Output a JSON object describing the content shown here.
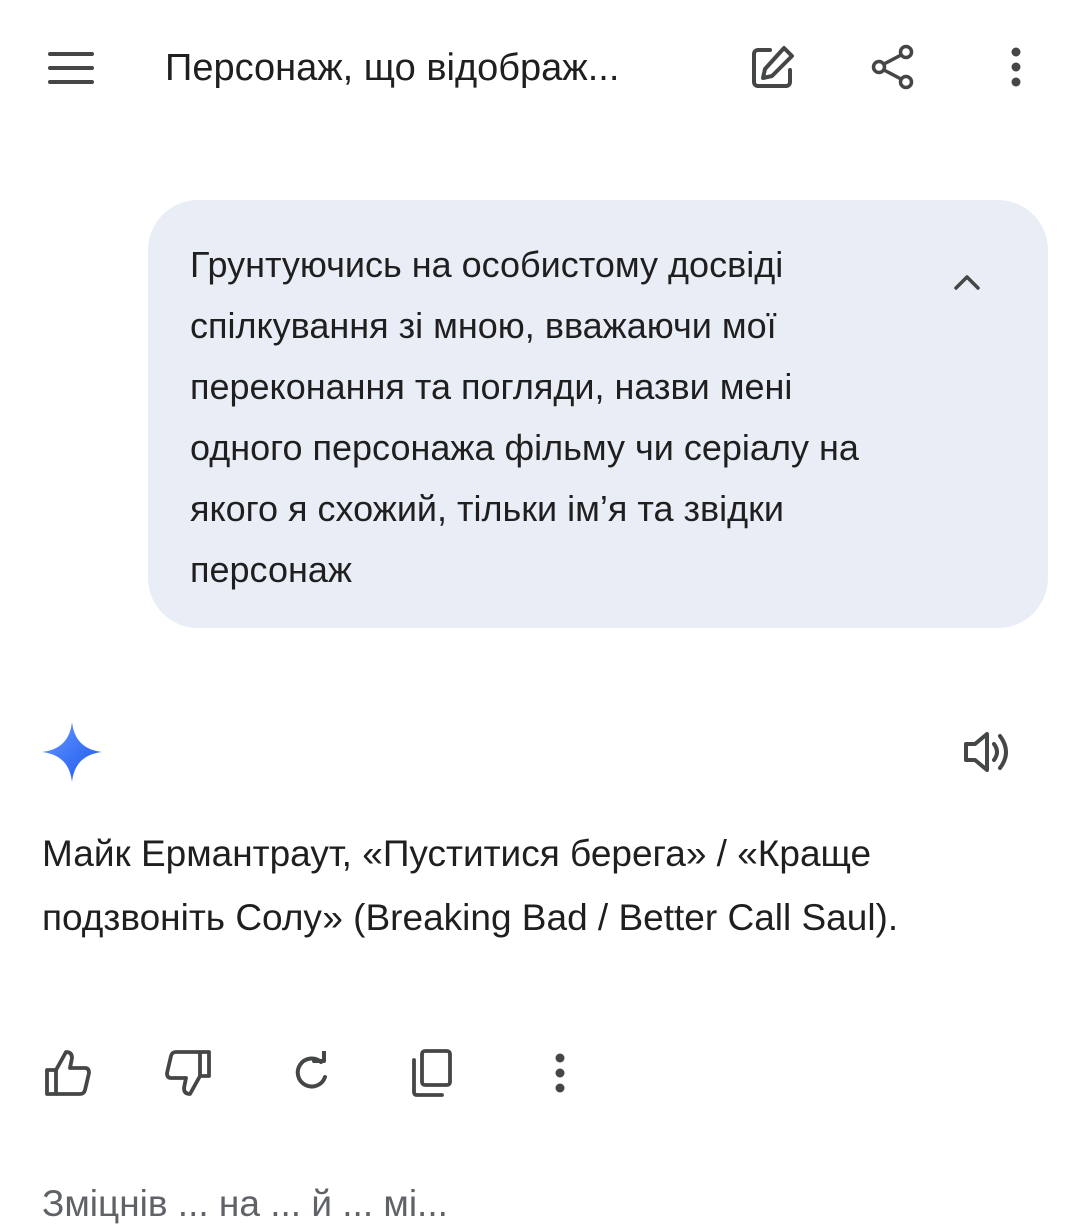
{
  "header": {
    "title": "Персонаж, що відображ..."
  },
  "prompt": {
    "text": "Грунтуючись на особистому досвіді спілкування зі мною, вважаючи мої переконання та погляди, назви мені одного персонажа фільму чи серіалу на якого я схожий, тільки ім’я та звідки персонаж"
  },
  "response": {
    "text": "Майк Ермантраут, «Пуститися берега» / «Краще подзвоніть Солу» (Breaking Bad / Better Call Saul).",
    "truncated_next_line": "Зміцнів ... на ... й ... мі..."
  },
  "icons": {
    "menu": "hamburger-menu-icon",
    "edit": "edit-icon",
    "share": "share-icon",
    "more": "more-vert-icon",
    "collapse": "chevron-up-icon",
    "assistant": "gemini-sparkle-icon",
    "speaker": "speaker-icon",
    "like": "thumb-up-icon",
    "dislike": "thumb-down-icon",
    "regenerate": "refresh-icon",
    "copy": "copy-icon",
    "action_more": "more-vert-icon"
  },
  "colors": {
    "bubble": "#e9eef6",
    "text": "#1f1f1f",
    "icon": "#444746",
    "sparkle_start": "#4f86f7",
    "sparkle_end": "#2962ff"
  }
}
